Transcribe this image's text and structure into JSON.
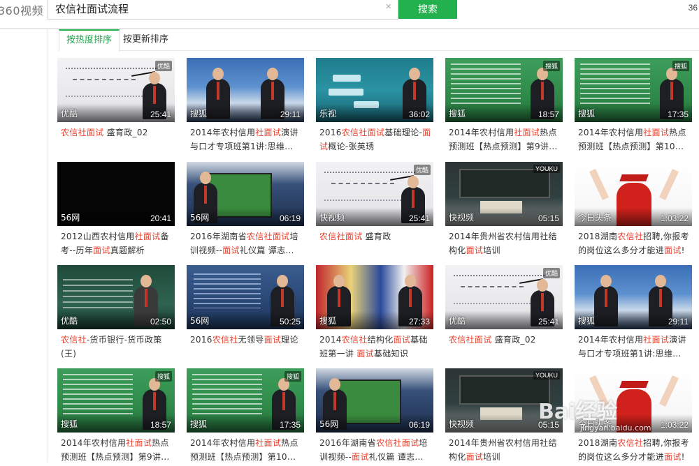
{
  "header": {
    "logo": "360视频",
    "search_value": "农信社面试流程",
    "clear_icon": "×",
    "search_button": "搜索",
    "right_number": "36"
  },
  "tabs": [
    {
      "label": "按热度排序",
      "active": true
    },
    {
      "label": "按更新排序",
      "active": false
    }
  ],
  "videos": [
    {
      "source": "优酷",
      "duration": "25:41",
      "title": [
        {
          "t": "农信社面试",
          "h": true
        },
        {
          "t": " 盛育政_02",
          "h": false
        }
      ],
      "thumb": "whiteboard"
    },
    {
      "source": "搜狐",
      "duration": "29:11",
      "title": [
        {
          "t": "2014年农村信用",
          "h": false
        },
        {
          "t": "社面试",
          "h": true
        },
        {
          "t": "演讲与口才专项班第1讲:思维...",
          "h": false
        }
      ],
      "thumb": "sydney"
    },
    {
      "source": "乐视",
      "duration": "36:02",
      "title": [
        {
          "t": "2016",
          "h": false
        },
        {
          "t": "农信社面试",
          "h": true
        },
        {
          "t": "基础理论-",
          "h": false
        },
        {
          "t": "面试",
          "h": true
        },
        {
          "t": "概论-张英琇",
          "h": false
        }
      ],
      "thumb": "teal-slide"
    },
    {
      "source": "搜狐",
      "duration": "18:57",
      "title": [
        {
          "t": "2014年农村信用",
          "h": false
        },
        {
          "t": "社面试",
          "h": true
        },
        {
          "t": "热点预测班【热点预测】第9讲...",
          "h": false
        }
      ],
      "thumb": "green-slide"
    },
    {
      "source": "搜狐",
      "duration": "17:35",
      "title": [
        {
          "t": "2014年农村信用",
          "h": false
        },
        {
          "t": "社面试",
          "h": true
        },
        {
          "t": "热点预测班【热点预测】第10...",
          "h": false
        }
      ],
      "thumb": "green-slide-2"
    },
    {
      "source": "56网",
      "duration": "20:41",
      "title": [
        {
          "t": "2012山西农村信用",
          "h": false
        },
        {
          "t": "社面试",
          "h": true
        },
        {
          "t": "备考--历年",
          "h": false
        },
        {
          "t": "面试",
          "h": true
        },
        {
          "t": "真题解析",
          "h": false
        }
      ],
      "thumb": "black"
    },
    {
      "source": "56网",
      "duration": "06:19",
      "title": [
        {
          "t": "2016年湖南省",
          "h": false
        },
        {
          "t": "农信社面试",
          "h": true
        },
        {
          "t": "培训视频--",
          "h": false
        },
        {
          "t": "面试",
          "h": true
        },
        {
          "t": "礼仪篇 谭志...",
          "h": false
        }
      ],
      "thumb": "tv"
    },
    {
      "source": "快视频",
      "duration": "25:41",
      "title": [
        {
          "t": "农信社面试",
          "h": true
        },
        {
          "t": " 盛育政",
          "h": false
        }
      ],
      "thumb": "whiteboard-2"
    },
    {
      "source": "快视频",
      "duration": "05:15",
      "title": [
        {
          "t": "2014年贵州省农村信用社结构化",
          "h": false
        },
        {
          "t": "面试",
          "h": true
        },
        {
          "t": "培训",
          "h": false
        }
      ],
      "thumb": "classroom"
    },
    {
      "source": "今日头条",
      "duration": "1:03:22",
      "title": [
        {
          "t": "2018湖南",
          "h": false
        },
        {
          "t": "农信社",
          "h": true
        },
        {
          "t": "招聘,你报考的岗位这么多分才能进",
          "h": false
        },
        {
          "t": "面试",
          "h": true
        },
        {
          "t": "!",
          "h": false
        }
      ],
      "thumb": "graduate"
    },
    {
      "source": "优酷",
      "duration": "02:50",
      "title": [
        {
          "t": "农信社",
          "h": true
        },
        {
          "t": "-货币银行-货币政策(王)",
          "h": false
        }
      ],
      "thumb": "money-slide"
    },
    {
      "source": "56网",
      "duration": "50:25",
      "title": [
        {
          "t": "2016",
          "h": false
        },
        {
          "t": "农信社",
          "h": true
        },
        {
          "t": "无领导",
          "h": false
        },
        {
          "t": "面试",
          "h": true
        },
        {
          "t": "理论",
          "h": false
        }
      ],
      "thumb": "blue-studio"
    },
    {
      "source": "搜狐",
      "duration": "27:33",
      "title": [
        {
          "t": "2014",
          "h": false
        },
        {
          "t": "农信社",
          "h": true
        },
        {
          "t": "结构化",
          "h": false
        },
        {
          "t": "面试",
          "h": true
        },
        {
          "t": "基础班第一讲 ",
          "h": false
        },
        {
          "t": "面试",
          "h": true
        },
        {
          "t": "基础知识",
          "h": false
        }
      ],
      "thumb": "flags"
    },
    {
      "source": "优酷",
      "duration": "25:41",
      "title": [
        {
          "t": "农信社面试",
          "h": true
        },
        {
          "t": " 盛育政_02",
          "h": false
        }
      ],
      "thumb": "whiteboard-3"
    },
    {
      "source": "搜狐",
      "duration": "29:11",
      "title": [
        {
          "t": "2014年农村信用",
          "h": false
        },
        {
          "t": "社面试",
          "h": true
        },
        {
          "t": "演讲与口才专项班第1讲:思维...",
          "h": false
        }
      ],
      "thumb": "sydney-2"
    },
    {
      "source": "搜狐",
      "duration": "18:57",
      "title": [
        {
          "t": "2014年农村信用",
          "h": false
        },
        {
          "t": "社面试",
          "h": true
        },
        {
          "t": "热点预测班【热点预测】第9讲...",
          "h": false
        }
      ],
      "thumb": "green-slide-3"
    },
    {
      "source": "搜狐",
      "duration": "17:35",
      "title": [
        {
          "t": "2014年农村信用",
          "h": false
        },
        {
          "t": "社面试",
          "h": true
        },
        {
          "t": "热点预测班【热点预测】第10...",
          "h": false
        }
      ],
      "thumb": "green-slide-4"
    },
    {
      "source": "56网",
      "duration": "06:19",
      "title": [
        {
          "t": "2016年湖南省",
          "h": false
        },
        {
          "t": "农信社面试",
          "h": true
        },
        {
          "t": "培训视频--",
          "h": false
        },
        {
          "t": "面试",
          "h": true
        },
        {
          "t": "礼仪篇 谭志...",
          "h": false
        }
      ],
      "thumb": "tv-2"
    },
    {
      "source": "快视频",
      "duration": "05:15",
      "title": [
        {
          "t": "2014年贵州省农村信用社结构化",
          "h": false
        },
        {
          "t": "面试",
          "h": true
        },
        {
          "t": "培训",
          "h": false
        }
      ],
      "thumb": "classroom-2"
    },
    {
      "source": "今日头条",
      "duration": "1:03:22",
      "title": [
        {
          "t": "2018湖南",
          "h": false
        },
        {
          "t": "农信社",
          "h": true
        },
        {
          "t": "招聘,你报考的岗位这么多分才能进",
          "h": false
        },
        {
          "t": "面试",
          "h": true
        },
        {
          "t": "!",
          "h": false
        }
      ],
      "thumb": "graduate-2"
    }
  ],
  "watermark": {
    "text": "Bai经验",
    "sub": "jingyan.baidu.com"
  },
  "colors": {
    "brand_green": "#22b14c",
    "highlight_red": "#e8402d"
  }
}
